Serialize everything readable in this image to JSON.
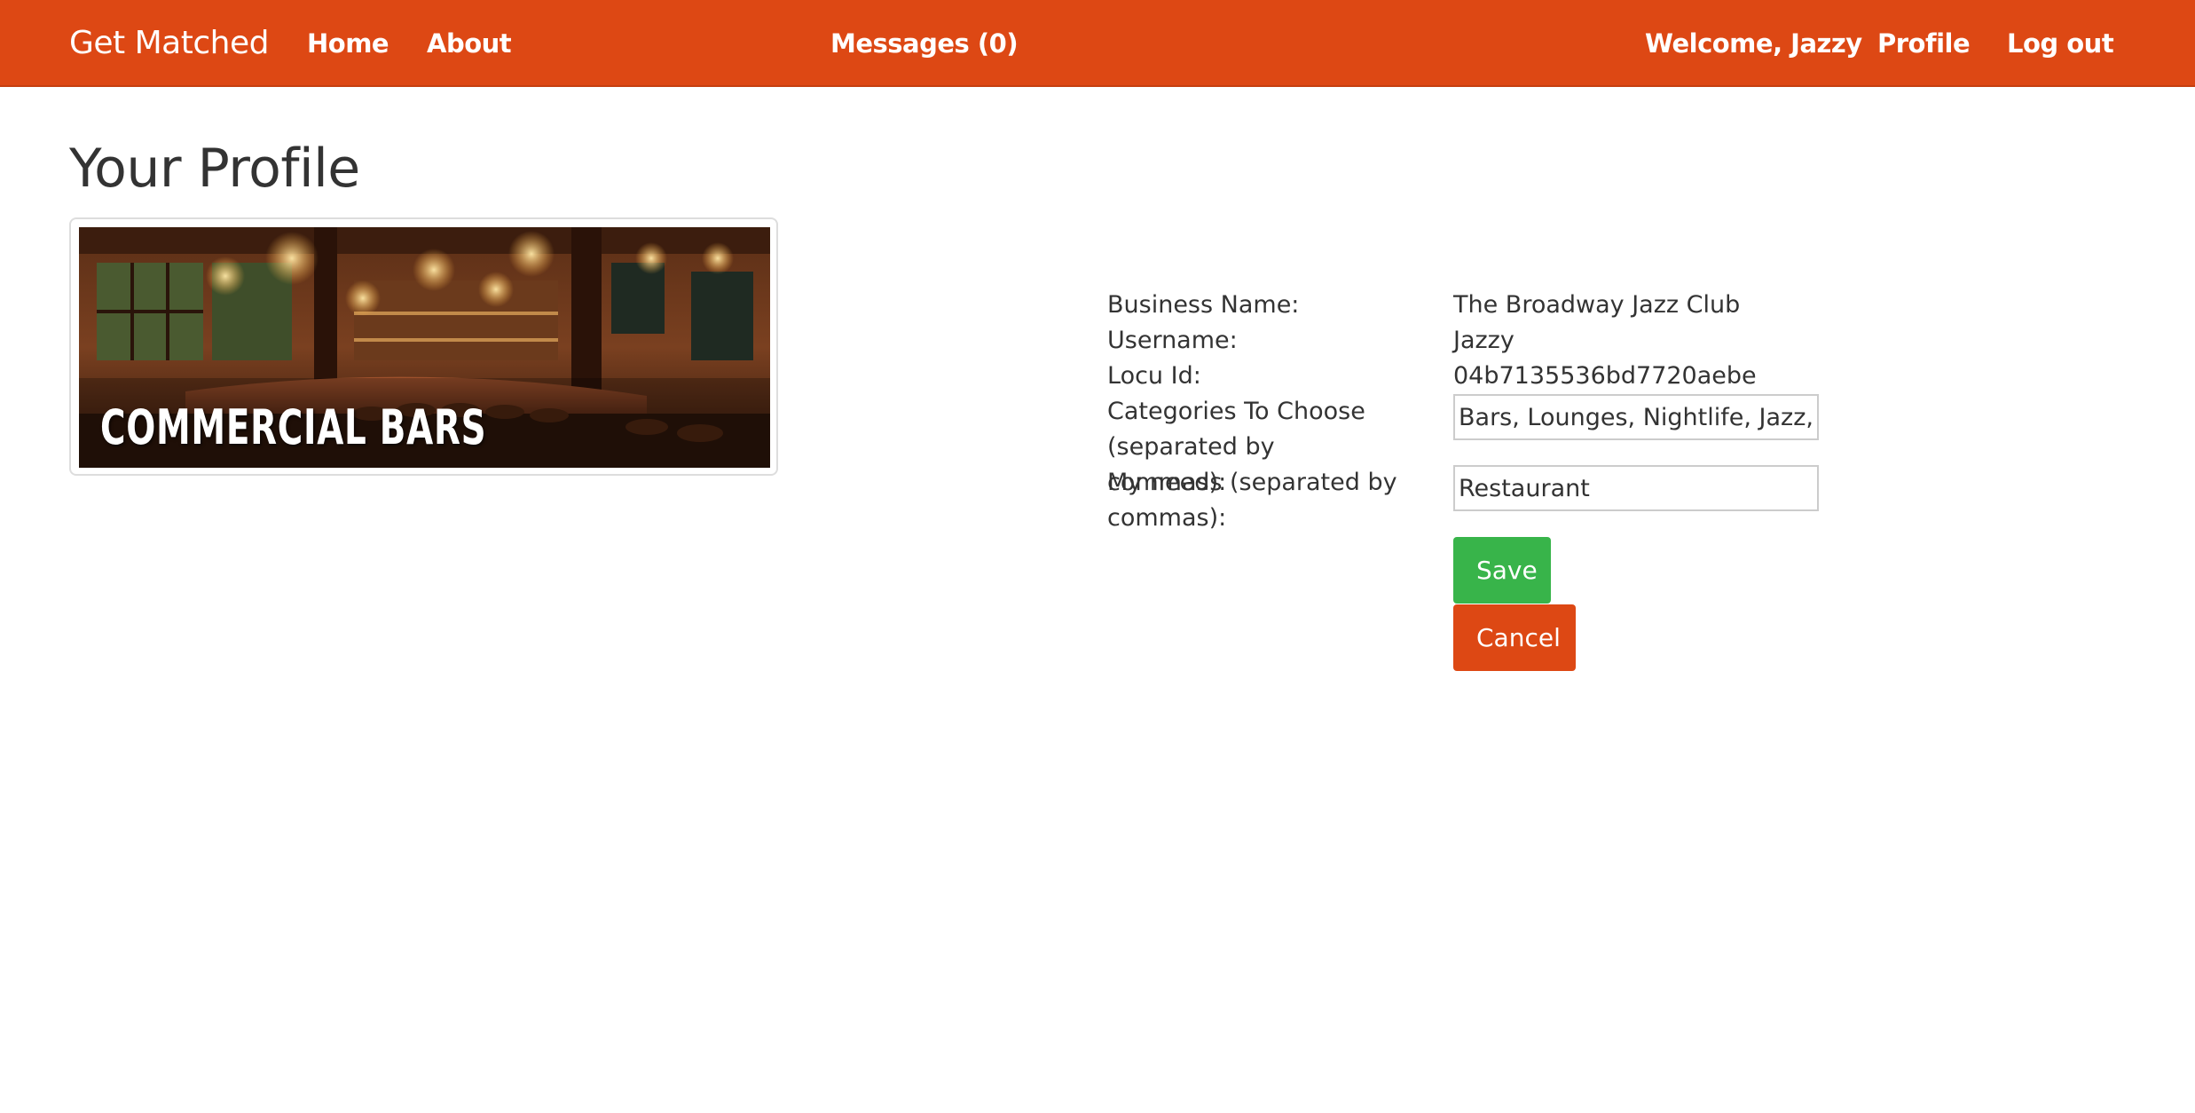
{
  "navbar": {
    "brand": "Get Matched",
    "home": "Home",
    "about": "About",
    "messages": "Messages (0)",
    "welcome": "Welcome, Jazzy",
    "profile": "Profile",
    "logout": "Log out"
  },
  "page": {
    "title": "Your Profile"
  },
  "banner": {
    "text": "COMMERCIAL BARS"
  },
  "profile": {
    "business_name_label": "Business Name:",
    "business_name_value": "The Broadway Jazz Club",
    "username_label": "Username:",
    "username_value": "Jazzy",
    "locu_id_label": "Locu Id:",
    "locu_id_value": "04b7135536bd7720aebe",
    "categories_label": "Categories To Choose (separated by commas):",
    "categories_value": "Bars, Lounges, Nightlife, Jazz, Music",
    "needs_label": "My needs (separated by commas):",
    "needs_value": "Restaurant"
  },
  "actions": {
    "save_label": "Save",
    "cancel_label": "Cancel"
  },
  "colors": {
    "navbar": "#dd4814",
    "save": "#38b44a",
    "cancel": "#dd4814"
  }
}
